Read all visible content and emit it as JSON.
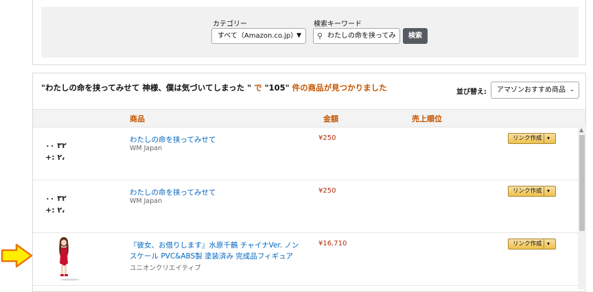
{
  "search": {
    "category_label": "カテゴリー",
    "category_value": "すべて（Amazon.co.jp）",
    "keyword_label": "検索キーワード",
    "keyword_value": "わたしの命を挟ってみ",
    "search_button": "検索"
  },
  "results": {
    "summary_query": "\"わたしの命を挟ってみせて 神様、僕は気づいてしまった \"",
    "summary_de": " で ",
    "summary_count": "\"105\"",
    "summary_tail": " 件の商品が見つかりました",
    "sort_label": "並び替え:",
    "sort_value": "アマゾンおすすめ商品"
  },
  "columns": {
    "product": "商品",
    "price": "金額",
    "rank": "売上順位"
  },
  "rows": [
    {
      "thumb_line1": "٣٢ ٠٠",
      "thumb_line2": "+: ٢،",
      "title": "わたしの命を挟ってみせて",
      "maker": "WM Japan",
      "price": "¥250",
      "link": "リンク作成"
    },
    {
      "thumb_line1": "٣٢ ٠٠",
      "thumb_line2": "+: ٢،",
      "title": "わたしの命を挟ってみせて",
      "maker": "WM Japan",
      "price": "¥250",
      "link": "リンク作成"
    },
    {
      "title": "『彼女、お借りします』水原千鶴 チャイナVer. ノンスケール PVC&ABS製 塗装済み 完成品フィギュア",
      "maker": "ユニオンクリエイティブ",
      "price": "¥16,710",
      "link": "リンク作成"
    }
  ],
  "colors": {
    "accent": "#c45500",
    "link": "#0066c0",
    "price": "#b12704",
    "button": "#f0c14b"
  }
}
